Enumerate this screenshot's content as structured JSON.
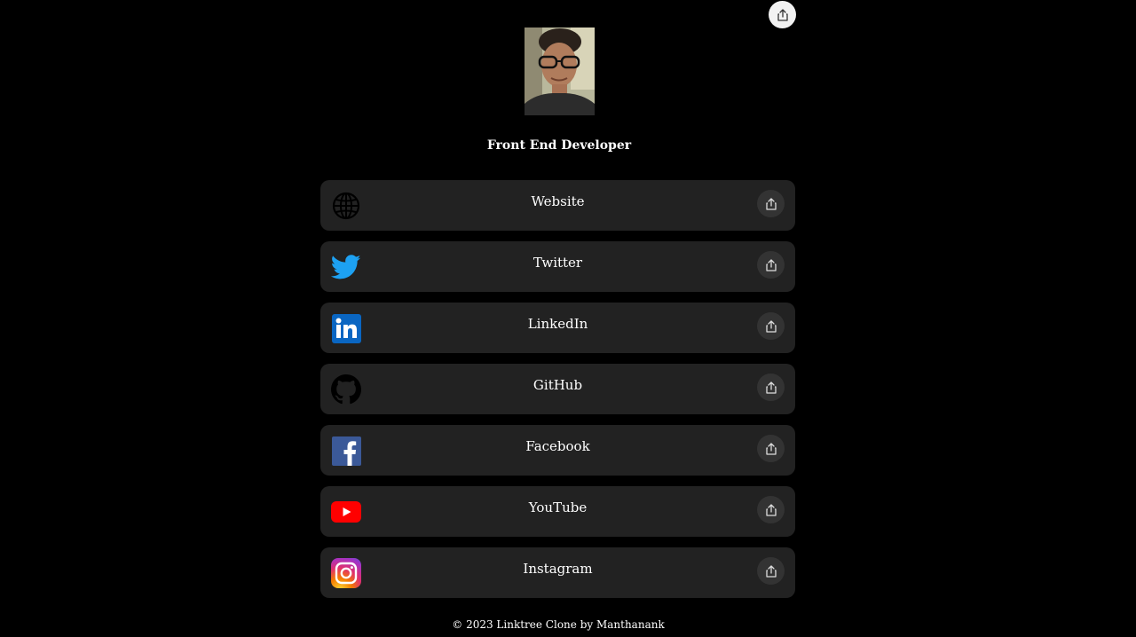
{
  "profile": {
    "headline": "Front End Developer",
    "avatar_icon": "profile-photo"
  },
  "page_share_icon": "share-icon",
  "links": [
    {
      "label": "Website",
      "icon": "globe-icon"
    },
    {
      "label": "Twitter",
      "icon": "twitter-icon"
    },
    {
      "label": "LinkedIn",
      "icon": "linkedin-icon"
    },
    {
      "label": "GitHub",
      "icon": "github-icon"
    },
    {
      "label": "Facebook",
      "icon": "facebook-icon"
    },
    {
      "label": "YouTube",
      "icon": "youtube-icon"
    },
    {
      "label": "Instagram",
      "icon": "instagram-icon"
    }
  ],
  "footer": {
    "text": "© 2023 Linktree Clone by Manthanank"
  },
  "colors": {
    "background": "#000000",
    "card": "#222222",
    "share_button": "#333333",
    "twitter": "#1DA1F2",
    "linkedin": "#0A66C2",
    "facebook": "#3B5998",
    "youtube": "#FF0000"
  }
}
